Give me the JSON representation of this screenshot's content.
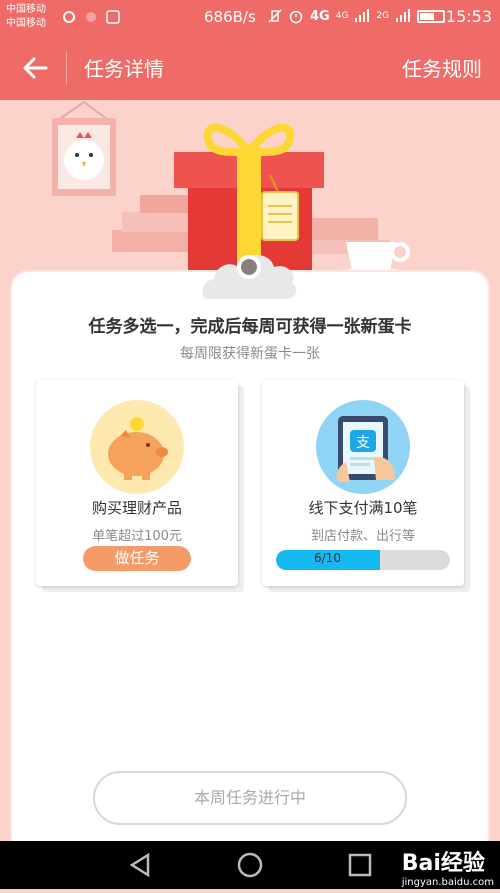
{
  "status_bar": {
    "carrier_1": "中国移动",
    "carrier_2": "中国移动",
    "net_speed": "686B/s",
    "network_1": "4G",
    "network_2": "4G",
    "network_3": "2G",
    "time": "15:53"
  },
  "nav": {
    "title": "任务详情",
    "rules_label": "任务规则"
  },
  "task_panel": {
    "headline": "任务多选一，完成后每周可获得一张新蛋卡",
    "subline": "每周限获得新蛋卡一张",
    "tasks": [
      {
        "title": "购买理财产品",
        "description": "单笔超过100元",
        "action_label": "做任务",
        "icon": "piggy-bank-icon"
      },
      {
        "title": "线下支付满10笔",
        "description": "到店付款、出行等",
        "progress_text": "6/10",
        "progress": 0.6,
        "icon": "alipay-tablet-icon",
        "icon_glyph": "支"
      }
    ]
  },
  "bottom_button": {
    "label": "本周任务进行中"
  },
  "watermark": {
    "brand": "Bai经验",
    "url": "jingyan.baidu.com"
  },
  "colors": {
    "header": "#ef6b68",
    "background": "#fbd3cb",
    "accent_orange": "#f59b6a",
    "progress_blue": "#15b9f0"
  }
}
